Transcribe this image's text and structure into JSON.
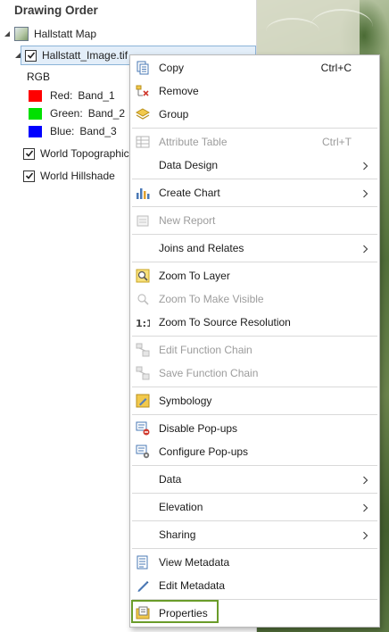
{
  "pane": {
    "title": "Drawing Order",
    "map_name": "Hallstatt Map",
    "selected_layer": "Hallstatt_Image.tif",
    "rgb_label": "RGB",
    "bands": [
      {
        "label": "Red:",
        "value": "Band_1",
        "color": "#ff0000"
      },
      {
        "label": "Green:",
        "value": "Band_2",
        "color": "#00e000"
      },
      {
        "label": "Blue:",
        "value": "Band_3",
        "color": "#0000ff"
      }
    ],
    "layers": [
      "World Topographic Map",
      "World Hillshade"
    ]
  },
  "menu": {
    "copy": "Copy",
    "copy_shortcut": "Ctrl+C",
    "remove": "Remove",
    "group": "Group",
    "attribute_table": "Attribute Table",
    "attribute_table_shortcut": "Ctrl+T",
    "data_design": "Data Design",
    "create_chart": "Create Chart",
    "new_report": "New Report",
    "joins_relates": "Joins and Relates",
    "zoom_to_layer": "Zoom To Layer",
    "zoom_visible": "Zoom To Make Visible",
    "zoom_source": "Zoom To Source Resolution",
    "edit_function_chain": "Edit Function Chain",
    "save_function_chain": "Save Function Chain",
    "symbology": "Symbology",
    "disable_popups": "Disable Pop-ups",
    "configure_popups": "Configure Pop-ups",
    "data": "Data",
    "elevation": "Elevation",
    "sharing": "Sharing",
    "view_metadata": "View Metadata",
    "edit_metadata": "Edit Metadata",
    "properties": "Properties"
  },
  "colors": {
    "highlight_border": "#6a9c2a",
    "selection_bg": "#e3eef9"
  }
}
